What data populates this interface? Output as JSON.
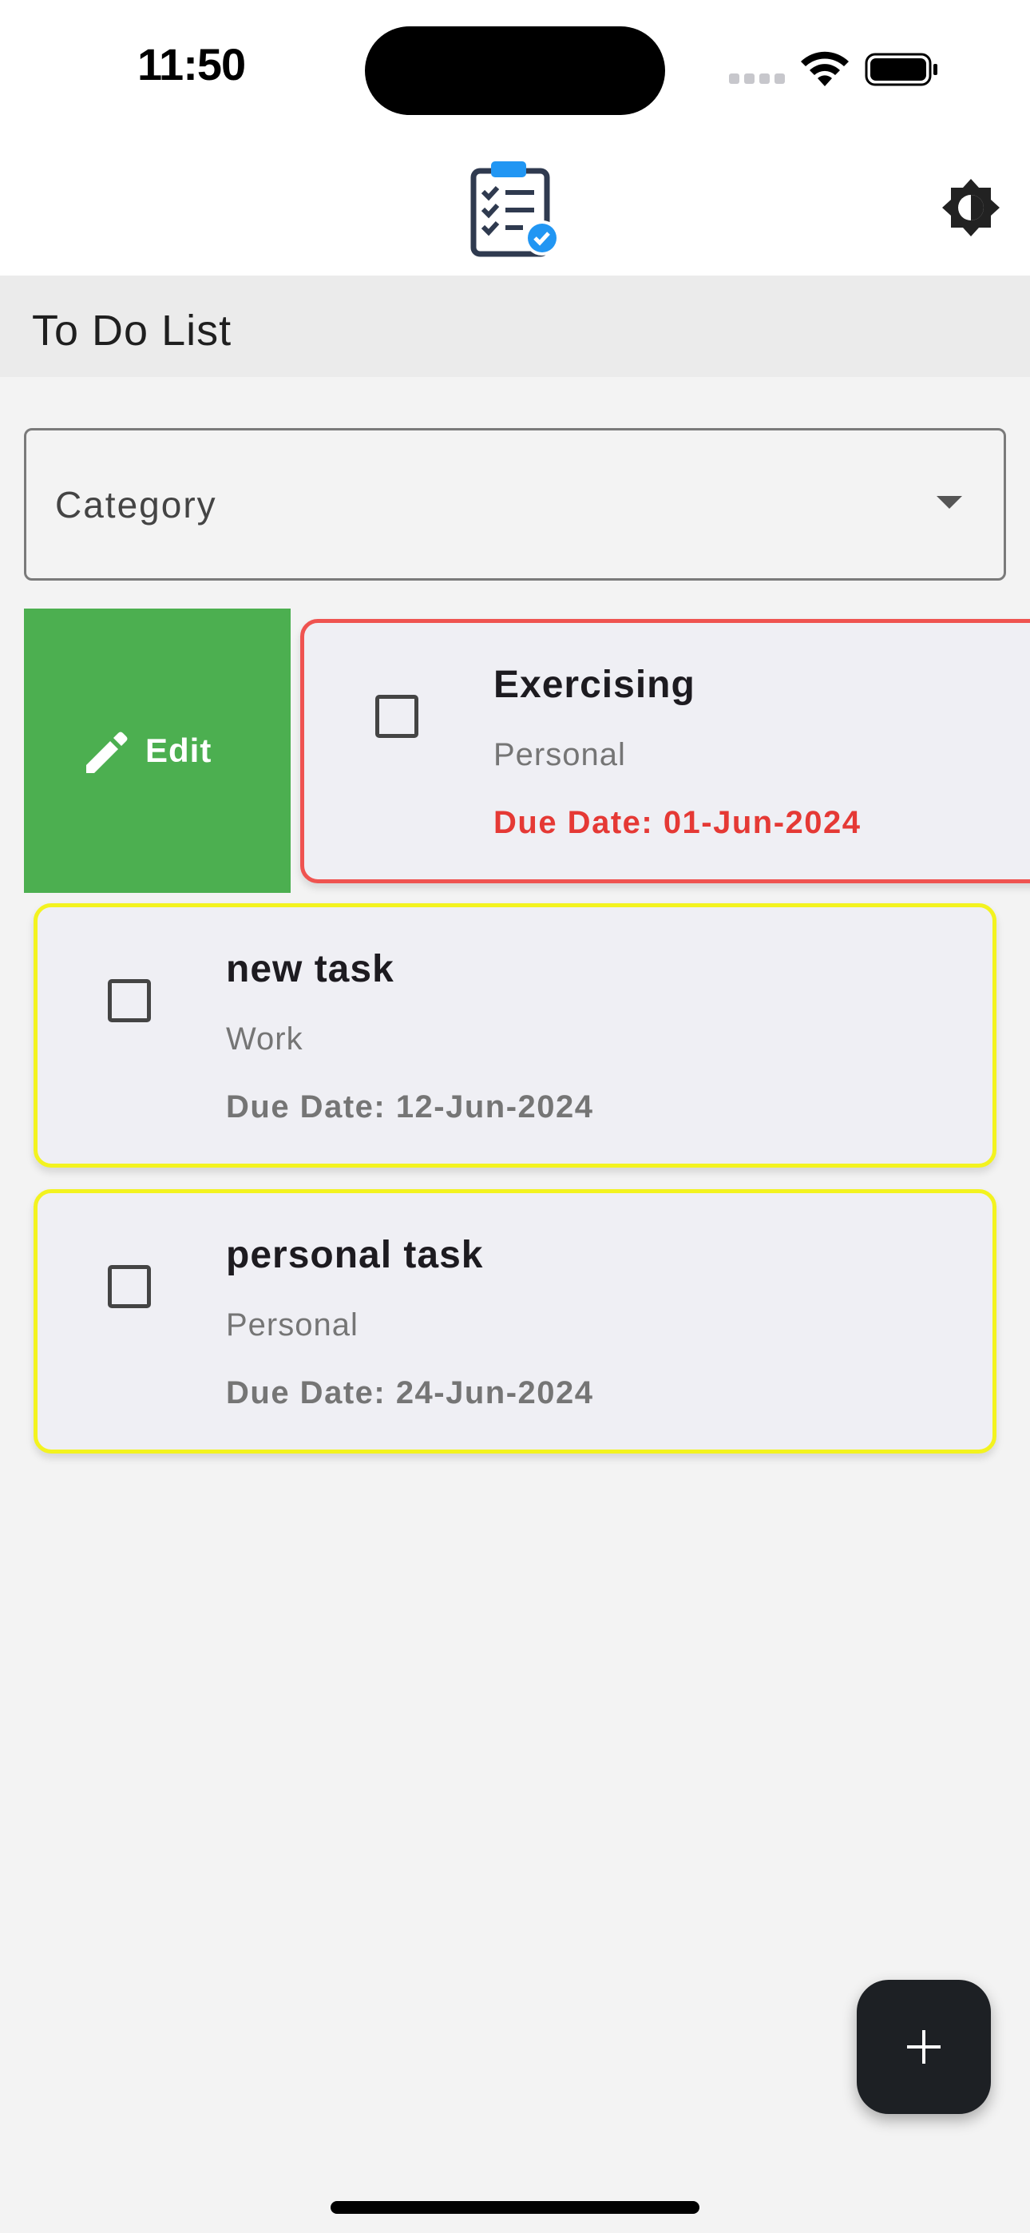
{
  "status_bar": {
    "time": "11:50"
  },
  "app_bar": {
    "logo": "clipboard-checklist-icon",
    "theme_toggle_icon": "brightness-contrast-icon"
  },
  "title_bar": {
    "title": "To Do List"
  },
  "filter": {
    "category_label": "Category"
  },
  "swipe_action": {
    "edit_label": "Edit",
    "icon": "pencil-icon",
    "color": "#4caf50"
  },
  "tasks": [
    {
      "name": "Exercising",
      "category": "Personal",
      "due": "Due Date: 01-Jun-2024",
      "border_color": "#ef5350",
      "due_color": "#e53935",
      "checked": false
    },
    {
      "name": "new task",
      "category": "Work",
      "due": "Due Date: 12-Jun-2024",
      "border_color": "#f3f31f",
      "due_color": "#757575",
      "checked": false
    },
    {
      "name": "personal task",
      "category": "Personal",
      "due": "Due Date: 24-Jun-2024",
      "border_color": "#f3f31f",
      "due_color": "#757575",
      "checked": false
    }
  ],
  "fab": {
    "icon": "plus-icon"
  }
}
